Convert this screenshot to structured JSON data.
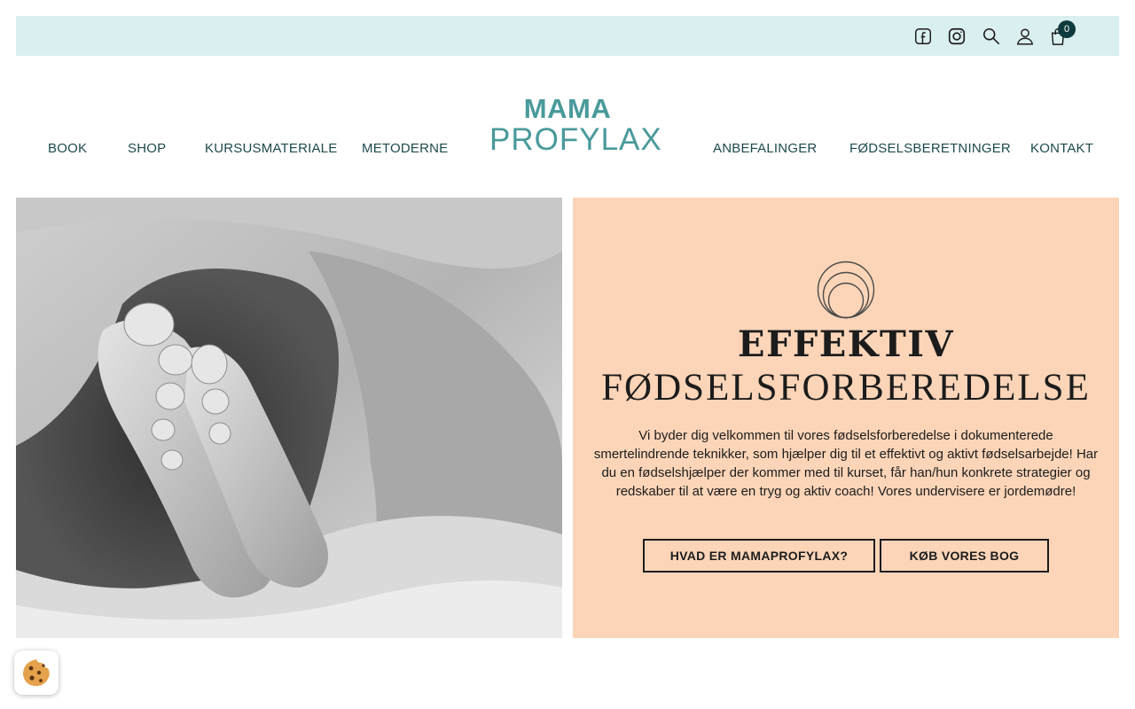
{
  "colors": {
    "topbar_bg": "#daeff0",
    "brand_teal": "#4a9a9b",
    "nav_text": "#1d4a4c",
    "panel_bg": "#fcd5b8",
    "badge_bg": "#0f3a3e"
  },
  "topbar": {
    "icons": [
      "facebook-icon",
      "instagram-icon",
      "search-icon",
      "user-icon",
      "cart-icon"
    ],
    "cart_count": "0"
  },
  "nav": {
    "left": [
      "BOOK",
      "SHOP",
      "KURSUSMATERIALE",
      "METODERNE"
    ],
    "right": [
      "ANBEFALINGER",
      "FØDSELSBERETNINGER",
      "KONTAKT"
    ]
  },
  "logo": {
    "line1": "MAMA",
    "line2": "PROFYLAX"
  },
  "hero": {
    "heading_bold": "EFFEKTIV",
    "heading_light": "FØDSELSFORBEREDELSE",
    "description": "Vi byder dig velkommen til vores fødselsforberedelse i dokumenterede smertelindrende teknikker, som hjælper dig til et effektivt og aktivt fødselsarbejde! Har du en fødselshjælper der kommer med til kurset, får han/hun konkrete strategier og redskaber til at være en tryg og aktiv coach! Vores undervisere er jordemødre!",
    "button_primary": "HVAD ER MAMAPROFYLAX?",
    "button_secondary": "KØB VORES BOG"
  },
  "cookie": {
    "icon": "cookie-icon"
  }
}
